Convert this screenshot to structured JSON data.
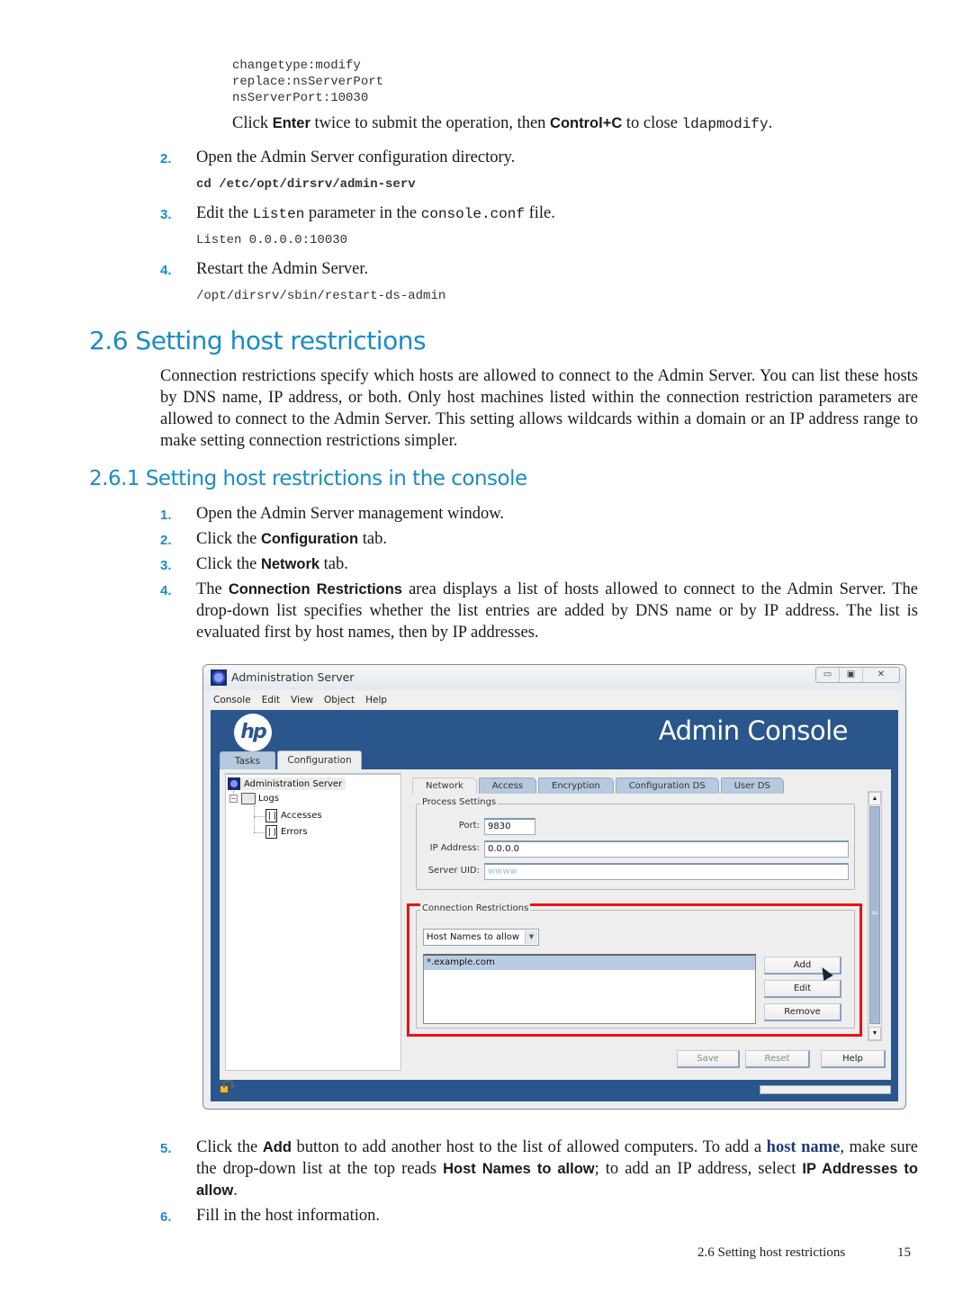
{
  "code_block_1": [
    "changetype:modify",
    "replace:nsServerPort",
    "nsServerPort:10030"
  ],
  "enter_note": {
    "t1": "Click ",
    "b1": "Enter",
    "t2": " twice to submit the operation, then ",
    "b2": "Control+C",
    "t3": " to close ",
    "code": "ldapmodify",
    "t4": "."
  },
  "steps_top": [
    {
      "num": "2.",
      "text": "Open the Admin Server configuration directory.",
      "code": "cd /etc/opt/dirsrv/admin-serv"
    },
    {
      "num": "3.",
      "t1": "Edit the ",
      "c1": "Listen",
      "t2": " parameter in the ",
      "c2": "console.conf",
      "t3": " file.",
      "code": "Listen 0.0.0.0:10030"
    },
    {
      "num": "4.",
      "text": "Restart the Admin Server.",
      "code": "/opt/dirsrv/sbin/restart-ds-admin"
    }
  ],
  "section": {
    "title": "2.6 Setting host restrictions",
    "intro": "Connection restrictions specify which hosts are allowed to connect to the Admin Server. You can list these hosts by DNS name, IP address, or both. Only host machines listed within the connection restriction parameters are allowed to connect to the Admin Server. This setting allows wildcards within a domain or an IP address range to make setting connection restrictions simpler."
  },
  "subsection": {
    "title": "2.6.1 Setting host restrictions in the console",
    "steps": [
      {
        "num": "1.",
        "text": "Open the Admin Server management window."
      },
      {
        "num": "2.",
        "t1": "Click the ",
        "b": "Configuration",
        "t2": " tab."
      },
      {
        "num": "3.",
        "t1": "Click the ",
        "b": "Network",
        "t2": " tab."
      },
      {
        "num": "4.",
        "t1": "The ",
        "b": "Connection Restrictions",
        "t2": " area displays a list of hosts allowed to connect to the Admin Server. The drop-down list specifies whether the list entries are added by DNS name or by IP address. The list is evaluated first by host names, then by IP addresses."
      }
    ],
    "steps_after": [
      {
        "num": "5.",
        "t1": "Click the ",
        "b1": "Add",
        "t2": " button to add another host to the list of allowed computers. To add a ",
        "link": "host name",
        "t3": ", make sure the drop-down list at the top reads ",
        "b2": "Host Names to allow",
        "t4": "; to add an IP address, select ",
        "b3": "IP Addresses to allow",
        "t5": "."
      },
      {
        "num": "6.",
        "text": "Fill in the host information."
      }
    ]
  },
  "screenshot": {
    "window_title": "Administration Server",
    "window_controls": {
      "minimize": "▭",
      "maximize": "▣",
      "close": "✕"
    },
    "menu": [
      "Console",
      "Edit",
      "View",
      "Object",
      "Help"
    ],
    "brand": "hp",
    "banner_title": "Admin Console",
    "top_tabs": [
      {
        "label": "Tasks",
        "active": false
      },
      {
        "label": "Configuration",
        "active": true
      }
    ],
    "tree": {
      "root": "Administration Server",
      "folder": "Logs",
      "children": [
        "Accesses",
        "Errors"
      ]
    },
    "sub_tabs": [
      {
        "label": "Network",
        "active": true
      },
      {
        "label": "Access",
        "active": false
      },
      {
        "label": "Encryption",
        "active": false
      },
      {
        "label": "Configuration DS",
        "active": false
      },
      {
        "label": "User DS",
        "active": false
      }
    ],
    "process_settings": {
      "legend": "Process Settings",
      "port_label": "Port:",
      "port_value": "9830",
      "ip_label": "IP Address:",
      "ip_value": "0.0.0.0",
      "uid_label": "Server UID:",
      "uid_value": "wwww"
    },
    "connection_restrictions": {
      "legend": "Connection Restrictions",
      "dropdown_value": "Host Names to allow",
      "list": [
        "*.example.com"
      ],
      "buttons": [
        "Add",
        "Edit",
        "Remove"
      ]
    },
    "footer_buttons": [
      {
        "label": "Save",
        "enabled": false
      },
      {
        "label": "Reset",
        "enabled": false
      },
      {
        "label": "Help",
        "enabled": true
      }
    ],
    "colors": {
      "banner": "#2a568c",
      "highlight": "#ee1111",
      "selection": "#b8cce4"
    }
  },
  "footer": {
    "section": "2.6 Setting host restrictions",
    "page": "15"
  }
}
